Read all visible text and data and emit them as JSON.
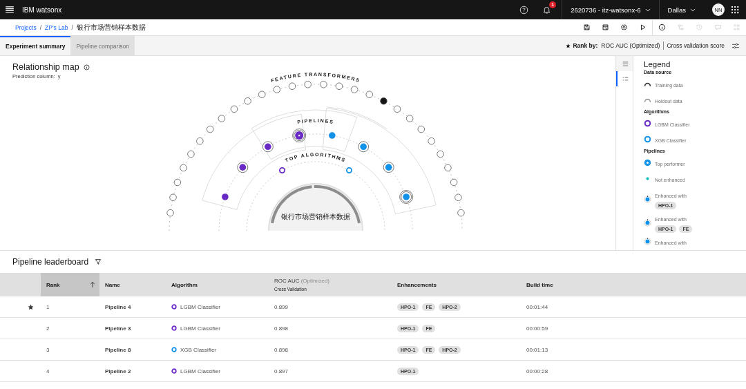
{
  "header": {
    "brand": "IBM watsonx",
    "notifications": "1",
    "account": "2620736 - itz-watsonx-6",
    "region": "Dallas",
    "avatar": "NN"
  },
  "breadcrumb": {
    "items": [
      {
        "label": "Projects",
        "link": true
      },
      {
        "label": "ZP's Lab",
        "link": true
      },
      {
        "label": "银行市场营销样本数据",
        "link": false
      }
    ],
    "separators": [
      "/",
      "/"
    ]
  },
  "toolbar": [
    {
      "kind": "save",
      "disabled": false
    },
    {
      "kind": "save-as",
      "disabled": false
    },
    {
      "kind": "settings",
      "disabled": false
    },
    {
      "kind": "run",
      "disabled": false
    },
    {
      "kind": "info",
      "disabled": false
    },
    {
      "kind": "flow",
      "disabled": true
    },
    {
      "kind": "history",
      "disabled": true
    },
    {
      "kind": "comment",
      "disabled": true
    },
    {
      "kind": "nodes",
      "disabled": true
    }
  ],
  "tabs": [
    {
      "label": "Experiment summary",
      "selected": true
    },
    {
      "label": "Pipeline comparison",
      "selected": false
    }
  ],
  "rank_by": {
    "label": "Rank by:",
    "metric": "ROC AUC (Optimized)",
    "score": "Cross validation score"
  },
  "map": {
    "title": "Relationship map",
    "prediction_label": "Prediction column:",
    "prediction_value": "y",
    "ring_labels": [
      "FEATURE TRANSFORMERS",
      "PIPELINES",
      "TOP ALGORITHMS"
    ],
    "center_label": "银行市场营销样本数据",
    "algorithms": [
      {
        "color": "#6929c4"
      },
      {
        "color": "#1192e8"
      }
    ],
    "pipelines": [
      {
        "color": "#6929c4",
        "kind": "top"
      },
      {
        "color": "#1192e8",
        "kind": "plain"
      },
      {
        "color": "#6929c4",
        "kind": "enhanced"
      },
      {
        "color": "#1192e8",
        "kind": "enhanced"
      },
      {
        "color": "#6929c4",
        "kind": "enhanced"
      },
      {
        "color": "#1192e8",
        "kind": "enhanced"
      },
      {
        "color": "#6929c4",
        "kind": "plain"
      },
      {
        "color": "#1192e8",
        "kind": "double"
      }
    ]
  },
  "view_switch": [
    {
      "kind": "list",
      "selected": false
    },
    {
      "kind": "legend",
      "selected": true
    }
  ],
  "legend": {
    "title": "Legend",
    "sections": [
      {
        "title": "Data source",
        "items": [
          {
            "kind": "training",
            "label": "Training data"
          },
          {
            "kind": "holdout",
            "label": "Holdout data"
          }
        ]
      },
      {
        "title": "Algorithms",
        "items": [
          {
            "kind": "lgbm",
            "label": "LGBM Classifier"
          },
          {
            "kind": "xgb",
            "label": "XGB Classifier"
          }
        ]
      },
      {
        "title": "Pipelines",
        "items": [
          {
            "kind": "top",
            "label": "Top performer"
          },
          {
            "kind": "plain",
            "label": "Not enhanced"
          },
          {
            "kind": "enhanced",
            "label": "Enhanced with",
            "chips": [
              "HPO-1"
            ]
          },
          {
            "kind": "enhanced",
            "label": "Enhanced with",
            "chips": [
              "HPO-1",
              "FE"
            ]
          },
          {
            "kind": "enhanced",
            "label": "Enhanced with"
          }
        ]
      }
    ]
  },
  "leaderboard": {
    "title": "Pipeline leaderboard",
    "columns": {
      "rank": "Rank",
      "name": "Name",
      "algorithm": "Algorithm",
      "metric": "ROC AUC",
      "metric_note": "(Optimized)",
      "metric_sub": "Cross Validation",
      "enhancements": "Enhancements",
      "build_time": "Build time"
    },
    "rows": [
      {
        "top": true,
        "rank": "1",
        "name": "Pipeline 4",
        "algorithm": "LGBM Classifier",
        "color": "#6929c4",
        "score": "0.899",
        "enhancements": [
          "HPO-1",
          "FE",
          "HPO-2"
        ],
        "build_time": "00:01:44"
      },
      {
        "top": false,
        "rank": "2",
        "name": "Pipeline 3",
        "algorithm": "LGBM Classifier",
        "color": "#6929c4",
        "score": "0.898",
        "enhancements": [
          "HPO-1",
          "FE"
        ],
        "build_time": "00:00:59"
      },
      {
        "top": false,
        "rank": "3",
        "name": "Pipeline 8",
        "algorithm": "XGB Classifier",
        "color": "#1192e8",
        "score": "0.898",
        "enhancements": [
          "HPO-1",
          "FE",
          "HPO-2"
        ],
        "build_time": "00:01:13"
      },
      {
        "top": false,
        "rank": "4",
        "name": "Pipeline 2",
        "algorithm": "LGBM Classifier",
        "color": "#6929c4",
        "score": "0.897",
        "enhancements": [
          "HPO-1"
        ],
        "build_time": "00:00:28"
      }
    ]
  }
}
